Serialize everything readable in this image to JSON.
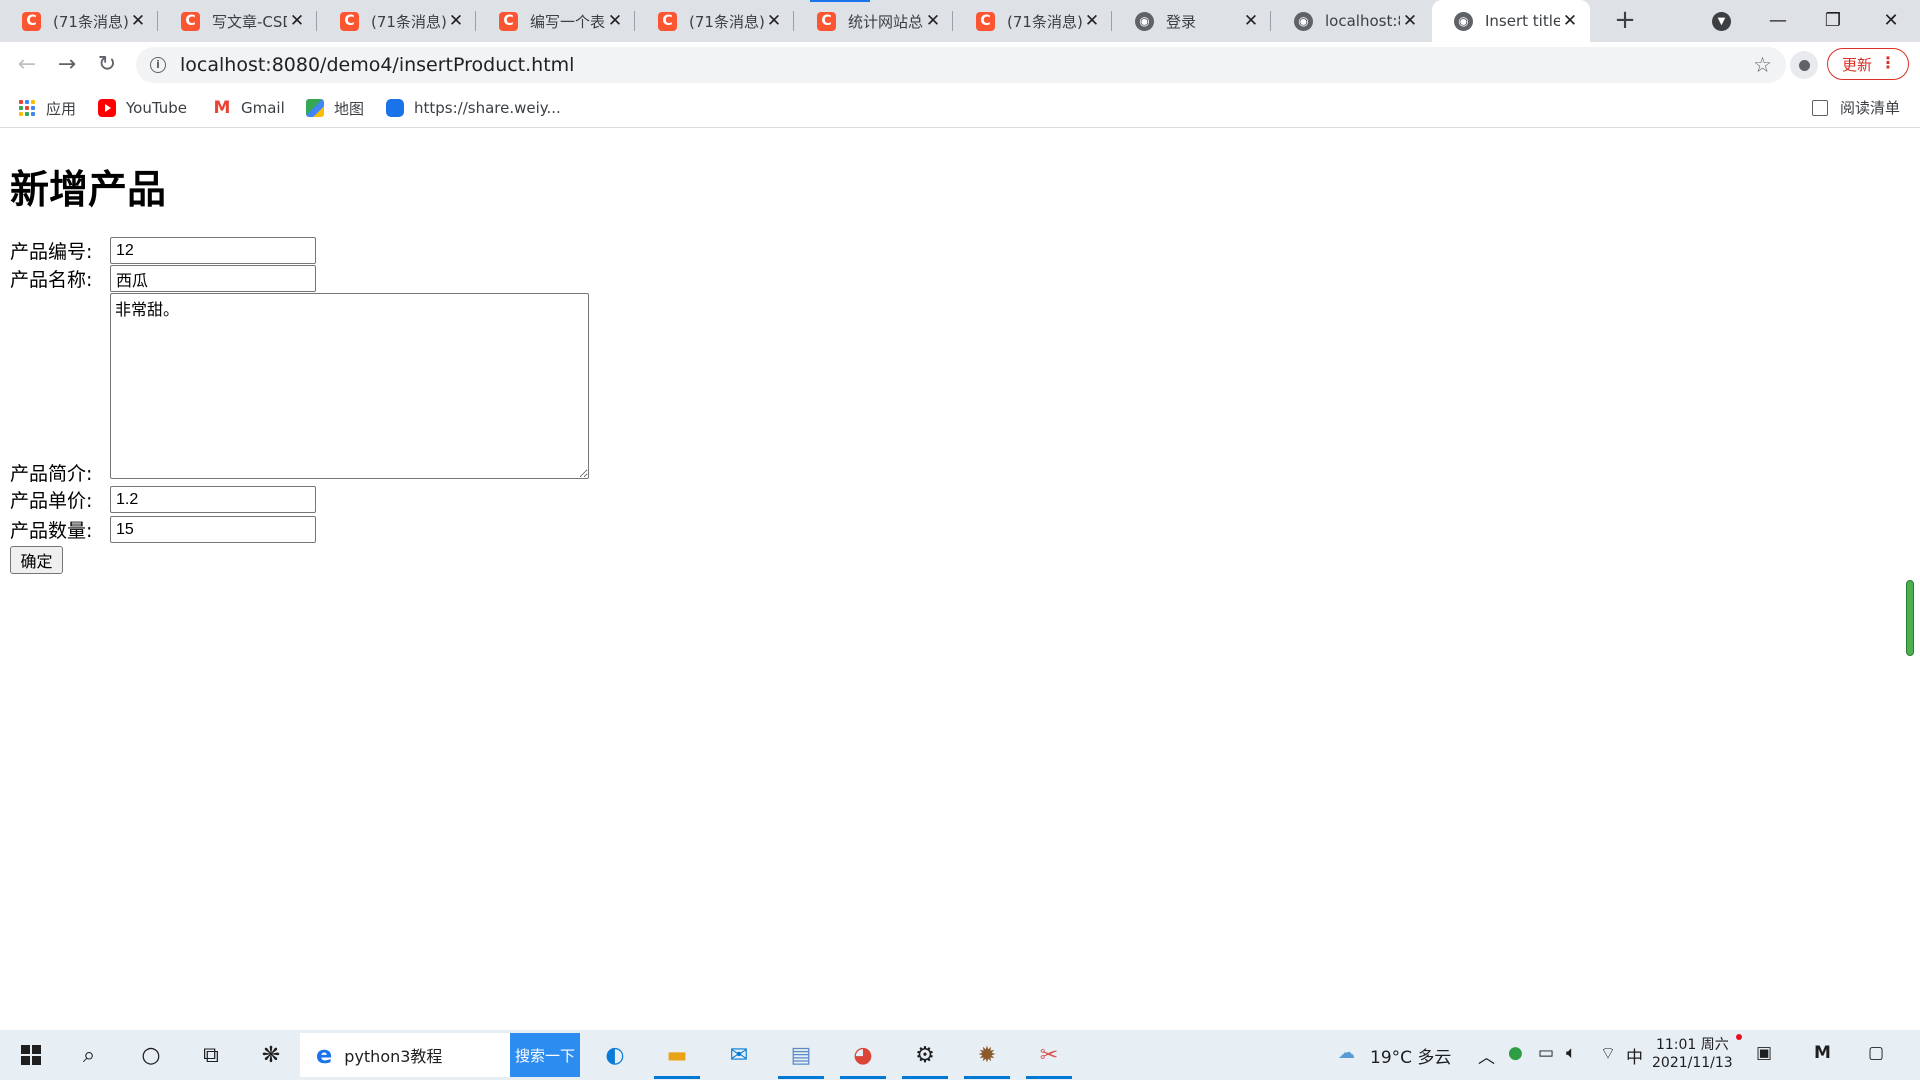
{
  "tabs": [
    {
      "title": "(71条消息)",
      "favicon": "csdn-icon"
    },
    {
      "title": "写文章-CSD",
      "favicon": "csdn-icon"
    },
    {
      "title": "(71条消息)",
      "favicon": "csdn-icon"
    },
    {
      "title": "编写一个表",
      "favicon": "csdn-icon"
    },
    {
      "title": "(71条消息)",
      "favicon": "csdn-icon"
    },
    {
      "title": "统计网站总",
      "favicon": "csdn-icon"
    },
    {
      "title": "(71条消息)",
      "favicon": "csdn-icon"
    },
    {
      "title": "登录",
      "favicon": "globe-icon"
    },
    {
      "title": "localhost:8",
      "favicon": "globe-icon"
    },
    {
      "title": "Insert title",
      "favicon": "globe-icon",
      "active": true
    }
  ],
  "toolbar": {
    "url": "localhost:8080/demo4/insertProduct.html",
    "update_label": "更新"
  },
  "bookmarks": [
    {
      "label": "应用",
      "icon": "apps-grid-icon"
    },
    {
      "label": "YouTube",
      "icon": "youtube-icon"
    },
    {
      "label": "Gmail",
      "icon": "gmail-icon"
    },
    {
      "label": "地图",
      "icon": "maps-icon"
    },
    {
      "label": "https://share.weiy...",
      "icon": "cloud-icon"
    }
  ],
  "reading_list": "阅读清单",
  "form": {
    "heading": "新增产品",
    "fields": {
      "id": {
        "label": "产品编号:",
        "value": "12"
      },
      "name": {
        "label": "产品名称:",
        "value": "西瓜"
      },
      "description": {
        "label": "产品简介:",
        "value": "非常甜。"
      },
      "price": {
        "label": "产品单价:",
        "value": "1.2"
      },
      "quantity": {
        "label": "产品数量:",
        "value": "15"
      }
    },
    "submit_label": "确定"
  },
  "taskbar": {
    "search_text": "python3教程",
    "search_button": "搜索一下",
    "weather": "19°C 多云",
    "ime": "中",
    "time": "11:01 周六",
    "date": "2021/11/13"
  },
  "colors": {
    "csdn_red": "#fc5531",
    "update_red": "#d93025",
    "taskbar_bg": "#e7eef4",
    "search_blue": "#2d8cf0"
  }
}
